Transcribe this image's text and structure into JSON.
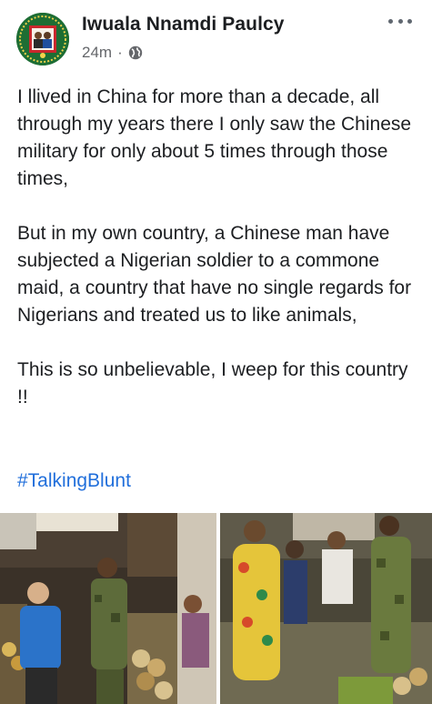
{
  "post": {
    "author": "Iwuala Nnamdi Paulcy",
    "time": "24m",
    "separator": "·",
    "privacy_icon": "globe-icon",
    "more_icon": "more-options-icon",
    "paragraphs": [
      "I llived in China for more than a decade, all through my years there I only saw the Chinese military for only about 5 times through those times,",
      "But in my own country, a Chinese man have subjected a Nigerian soldier to a commone maid, a country that have no single regards for Nigerians and treated us to like animals,",
      "This is so unbelievable, I weep for this country !!"
    ],
    "hashtag": "#TalkingBlunt"
  },
  "colors": {
    "text": "#1c1e21",
    "secondary": "#65676b",
    "link": "#216fdb"
  }
}
